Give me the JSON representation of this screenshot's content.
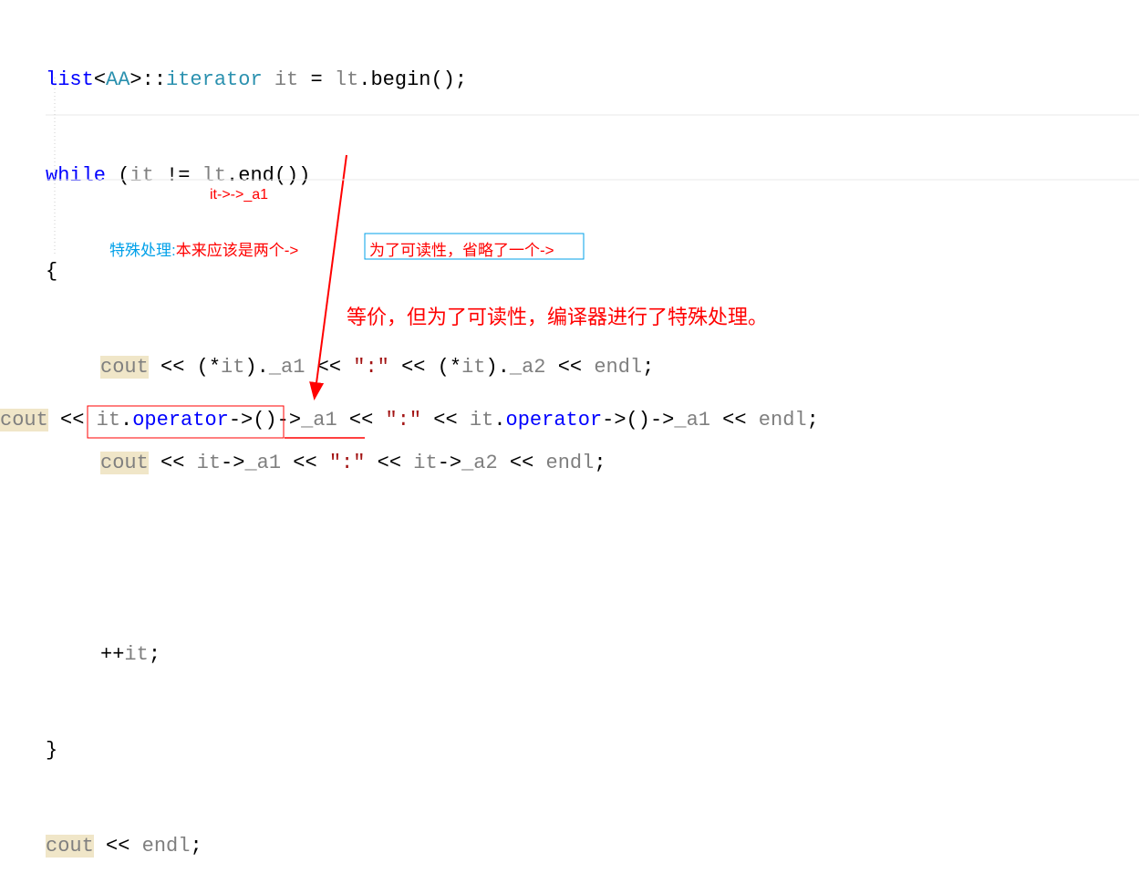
{
  "code": {
    "line1": {
      "a": "list",
      "b": "<",
      "c": "AA",
      "d": ">::",
      "e": "iterator",
      "f": " ",
      "g": "it",
      "h": " = ",
      "i": "lt",
      "j": ".begin();"
    },
    "line2": {
      "a": "while",
      "b": " (",
      "c": "it",
      "d": " != ",
      "e": "lt",
      "f": ".end())"
    },
    "line3": "{",
    "line4": {
      "a": "cout",
      "b": " << (*",
      "c": "it",
      "d": ").",
      "e": "_a1",
      "f": " << ",
      "g": "\":\"",
      "h": " << (*",
      "i": "it",
      "j": ").",
      "k": "_a2",
      "l": " << ",
      "m": "endl",
      "n": ";"
    },
    "line5": {
      "a": "cout",
      "b": " << ",
      "c": "it",
      "d": "->",
      "e": "_a1",
      "f": " << ",
      "g": "\":\"",
      "h": " << ",
      "i": "it",
      "j": "->",
      "k": "_a2",
      "l": " << ",
      "m": "endl",
      "n": ";"
    },
    "line6": "",
    "line7": {
      "a": "++",
      "b": "it",
      "c": ";"
    },
    "line8": "}",
    "line9": {
      "a": "cout",
      "b": " << ",
      "c": "endl",
      "d": ";"
    },
    "bottom": {
      "a": "cout",
      "b": " << ",
      "c": "it",
      "d": ".",
      "e": "operator",
      "f": "->()->",
      "g": "_a1",
      "h": " << ",
      "i": "\":\"",
      "j": " << ",
      "k": "it",
      "l": ".",
      "m": "operator",
      "n": "->()->",
      "o": "_a1",
      "p": " << ",
      "q": "endl",
      "r": ";"
    }
  },
  "annotations": {
    "arrow_label": "it->->_a1",
    "special_prefix": "特殊处理:",
    "special_text": "本来应该是两个->",
    "readability_box": "为了可读性，省略了一个->",
    "equivalence": "等价，但为了可读性，编译器进行了特殊处理。"
  }
}
